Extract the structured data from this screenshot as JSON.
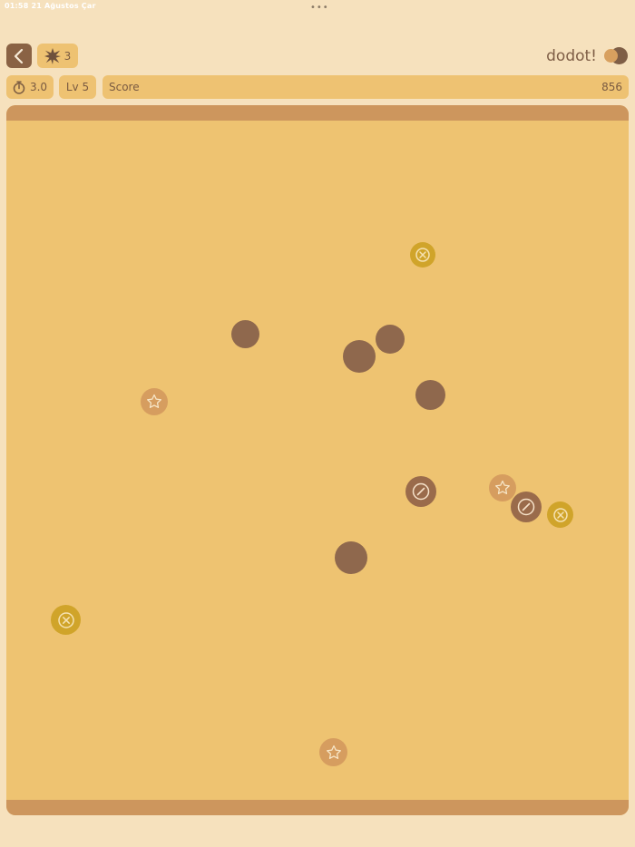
{
  "status": {
    "time_date": "01:58  21 Ağustos Çar",
    "menu_dots": "•••"
  },
  "header": {
    "bomb_count": "3",
    "brand": "dodot!"
  },
  "stats": {
    "timer": "3.0",
    "level": "Lv 5",
    "score_label": "Score",
    "score_value": "856"
  },
  "colors": {
    "background": "#f6e1bd",
    "board": "#eec371",
    "board_rail": "#cd965d",
    "plain_dot": "#8f684d",
    "star_dot": "#d69d5f",
    "blocked_dot": "#d0a42a",
    "slash_dot": "#9a6b4b"
  },
  "dots": [
    {
      "kind": "blocked"
    },
    {
      "kind": "plain"
    },
    {
      "kind": "plain"
    },
    {
      "kind": "plain"
    },
    {
      "kind": "plain"
    },
    {
      "kind": "star"
    },
    {
      "kind": "slash"
    },
    {
      "kind": "star"
    },
    {
      "kind": "slash"
    },
    {
      "kind": "blocked"
    },
    {
      "kind": "plain"
    },
    {
      "kind": "blocked"
    },
    {
      "kind": "star"
    }
  ]
}
